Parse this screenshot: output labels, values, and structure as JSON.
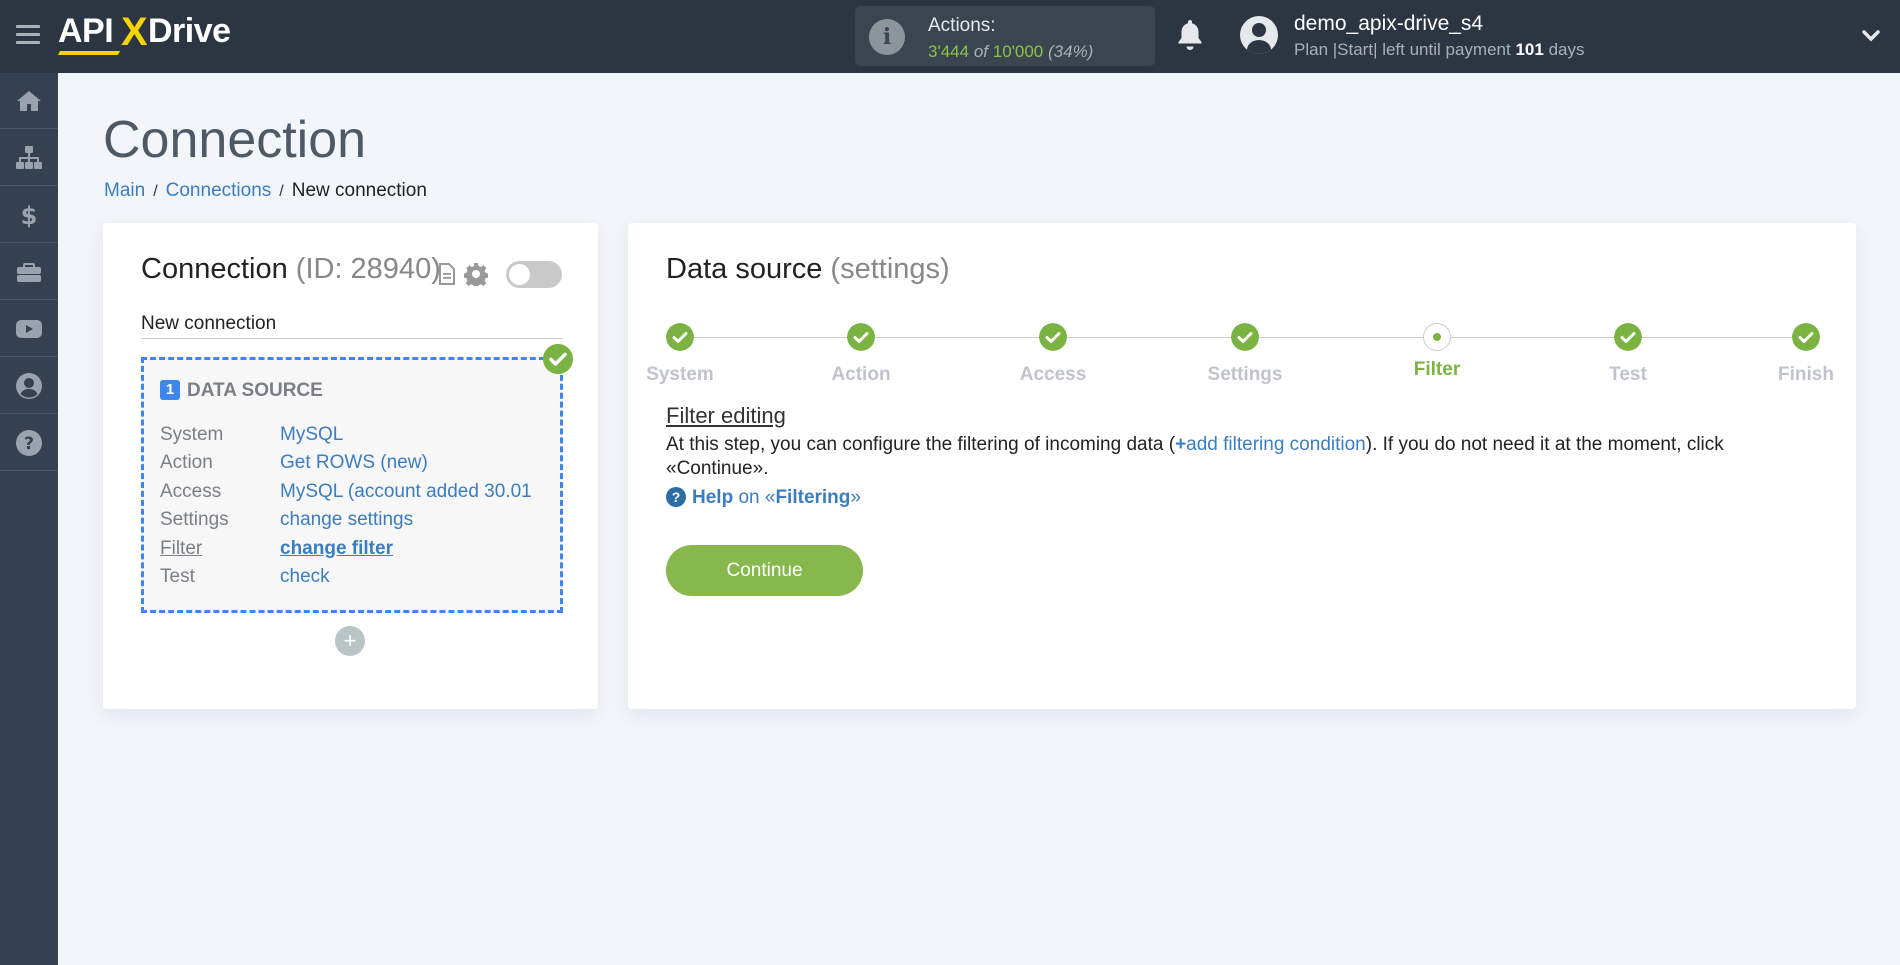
{
  "header": {
    "logo": {
      "part1": "API",
      "part2": "X",
      "part3": "Drive"
    },
    "actions": {
      "label": "Actions:",
      "used": "3'444",
      "of": "of",
      "total": "10'000",
      "percent": "(34%)"
    },
    "user": {
      "name": "demo_apix-drive_s4",
      "plan_prefix": "Plan |Start| left until payment",
      "days": "101",
      "days_suffix": "days"
    }
  },
  "sidebar": {
    "items": [
      {
        "name": "home",
        "icon": "home-icon"
      },
      {
        "name": "connections",
        "icon": "sitemap-icon"
      },
      {
        "name": "billing",
        "icon": "dollar-icon"
      },
      {
        "name": "services",
        "icon": "briefcase-icon"
      },
      {
        "name": "video",
        "icon": "youtube-icon"
      },
      {
        "name": "account",
        "icon": "user-circle-icon"
      },
      {
        "name": "help",
        "icon": "question-icon"
      }
    ]
  },
  "page": {
    "title": "Connection",
    "breadcrumb": [
      {
        "label": "Main"
      },
      {
        "label": "Connections"
      },
      {
        "label": "New connection"
      }
    ]
  },
  "connection": {
    "title": "Connection",
    "id_label": "(ID: 28940)",
    "enabled": false,
    "name_value": "New connection",
    "block": {
      "number": "1",
      "title": "DATA SOURCE",
      "status": "complete",
      "rows": [
        {
          "key": "System",
          "value": "MySQL"
        },
        {
          "key": "Action",
          "value": "Get ROWS (new)"
        },
        {
          "key": "Access",
          "value": "MySQL (account added 30.01"
        },
        {
          "key": "Settings",
          "value": "change settings"
        },
        {
          "key": "Filter",
          "value": "change filter"
        },
        {
          "key": "Test",
          "value": "check"
        }
      ]
    },
    "add_label": "+"
  },
  "datasource": {
    "title": "Data source",
    "subtitle": "(settings)",
    "steps": [
      {
        "label": "System",
        "state": "done"
      },
      {
        "label": "Action",
        "state": "done"
      },
      {
        "label": "Access",
        "state": "done"
      },
      {
        "label": "Settings",
        "state": "done"
      },
      {
        "label": "Filter",
        "state": "current"
      },
      {
        "label": "Test",
        "state": "done"
      },
      {
        "label": "Finish",
        "state": "done"
      }
    ],
    "filter": {
      "title": "Filter editing",
      "text_before": "At this step, you can configure the filtering of incoming data (",
      "link_plus": "+",
      "link_label": "add filtering condition",
      "text_after": "). If you do not need it at the moment, click «Continue».",
      "help_icon": "?",
      "help_label": "Help",
      "help_on": "on «",
      "help_topic": "Filtering",
      "help_close": "»"
    },
    "continue_label": "Continue"
  },
  "colors": {
    "header_bg": "#2c3542",
    "sidebar_bg": "#354150",
    "accent_green": "#7bb342",
    "link_blue": "#3b7dbe",
    "dashed_blue": "#3d87ec",
    "logo_yellow": "#f5d400"
  }
}
